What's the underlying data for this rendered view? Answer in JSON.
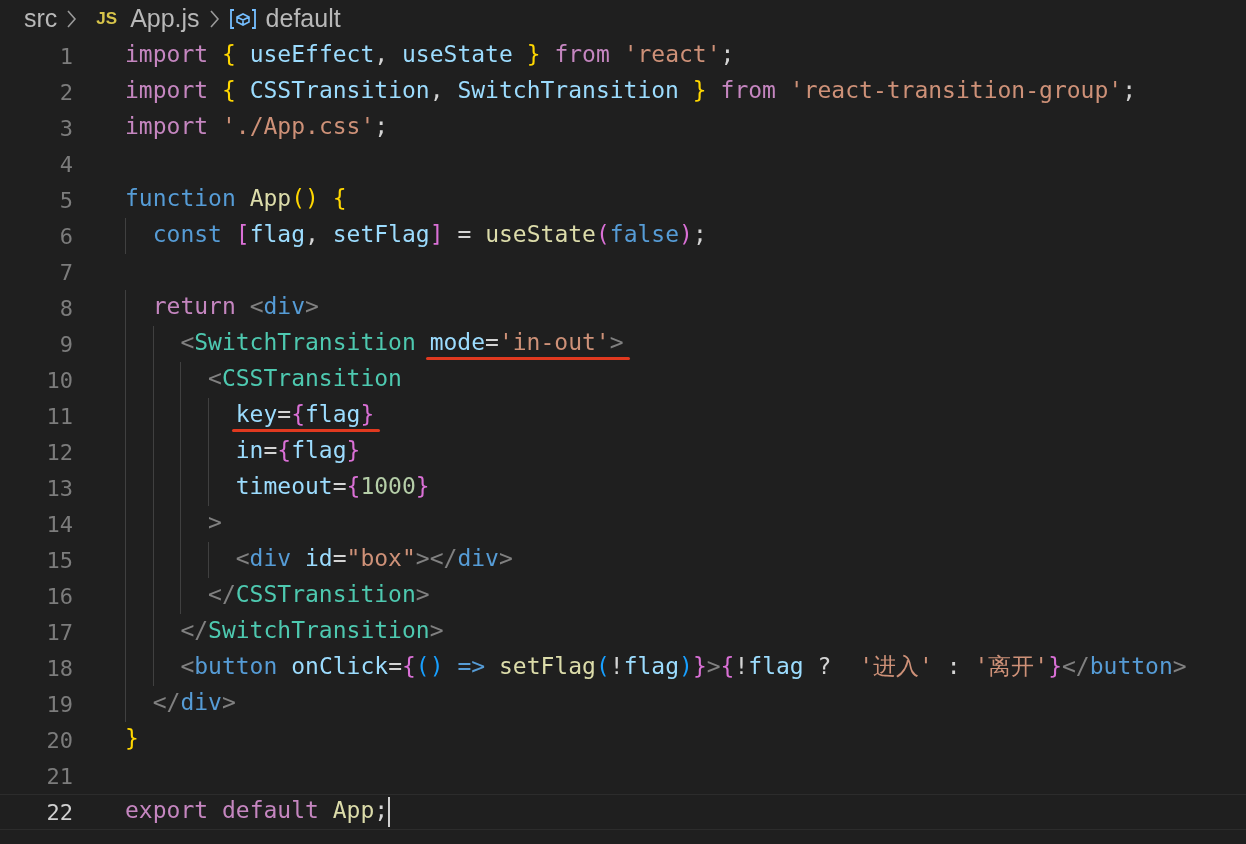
{
  "breadcrumb": {
    "folder": "src",
    "file_badge": "JS",
    "file": "App.js",
    "symbol": "default"
  },
  "lines": [
    {
      "number": "1",
      "current": false,
      "text": "import { useEffect, useState } from 'react';"
    },
    {
      "number": "2",
      "current": false,
      "text": "import { CSSTransition, SwitchTransition } from 'react-transition-group';"
    },
    {
      "number": "3",
      "current": false,
      "text": "import './App.css';"
    },
    {
      "number": "4",
      "current": false
    },
    {
      "number": "5",
      "current": false,
      "text": "function App() {"
    },
    {
      "number": "6",
      "current": false,
      "text": "  const [flag, setFlag] = useState(false);"
    },
    {
      "number": "7",
      "current": false
    },
    {
      "number": "8",
      "current": false,
      "text": "  return <div>"
    },
    {
      "number": "9",
      "current": false,
      "segments": [
        {
          "text": "    <SwitchTransition",
          "underlined": false
        },
        {
          "text": "mode='in-out'>",
          "underlined": true
        }
      ]
    },
    {
      "number": "10",
      "current": false,
      "text": "      <CSSTransition"
    },
    {
      "number": "11",
      "current": false,
      "segments": [
        {
          "text": "        key={flag}",
          "underlined": true
        }
      ]
    },
    {
      "number": "12",
      "current": false,
      "text": "        in={flag}"
    },
    {
      "number": "13",
      "current": false,
      "text": "        timeout={1000}"
    },
    {
      "number": "14",
      "current": false,
      "text": "      >"
    },
    {
      "number": "15",
      "current": false,
      "text": "        <div id=\"box\"></div>"
    },
    {
      "number": "16",
      "current": false,
      "text": "      </CSSTransition>"
    },
    {
      "number": "17",
      "current": false,
      "text": "    </SwitchTransition>"
    },
    {
      "number": "18",
      "current": false,
      "text": "    <button onClick={() => setFlag(!flag)}>{!flag ?  '进入' : '离开'}</button>"
    },
    {
      "number": "19",
      "current": false,
      "text": "  </div>"
    },
    {
      "number": "20",
      "current": false,
      "text": "}"
    },
    {
      "number": "21",
      "current": false
    },
    {
      "number": "22",
      "current": true,
      "text": "export default App;"
    }
  ]
}
